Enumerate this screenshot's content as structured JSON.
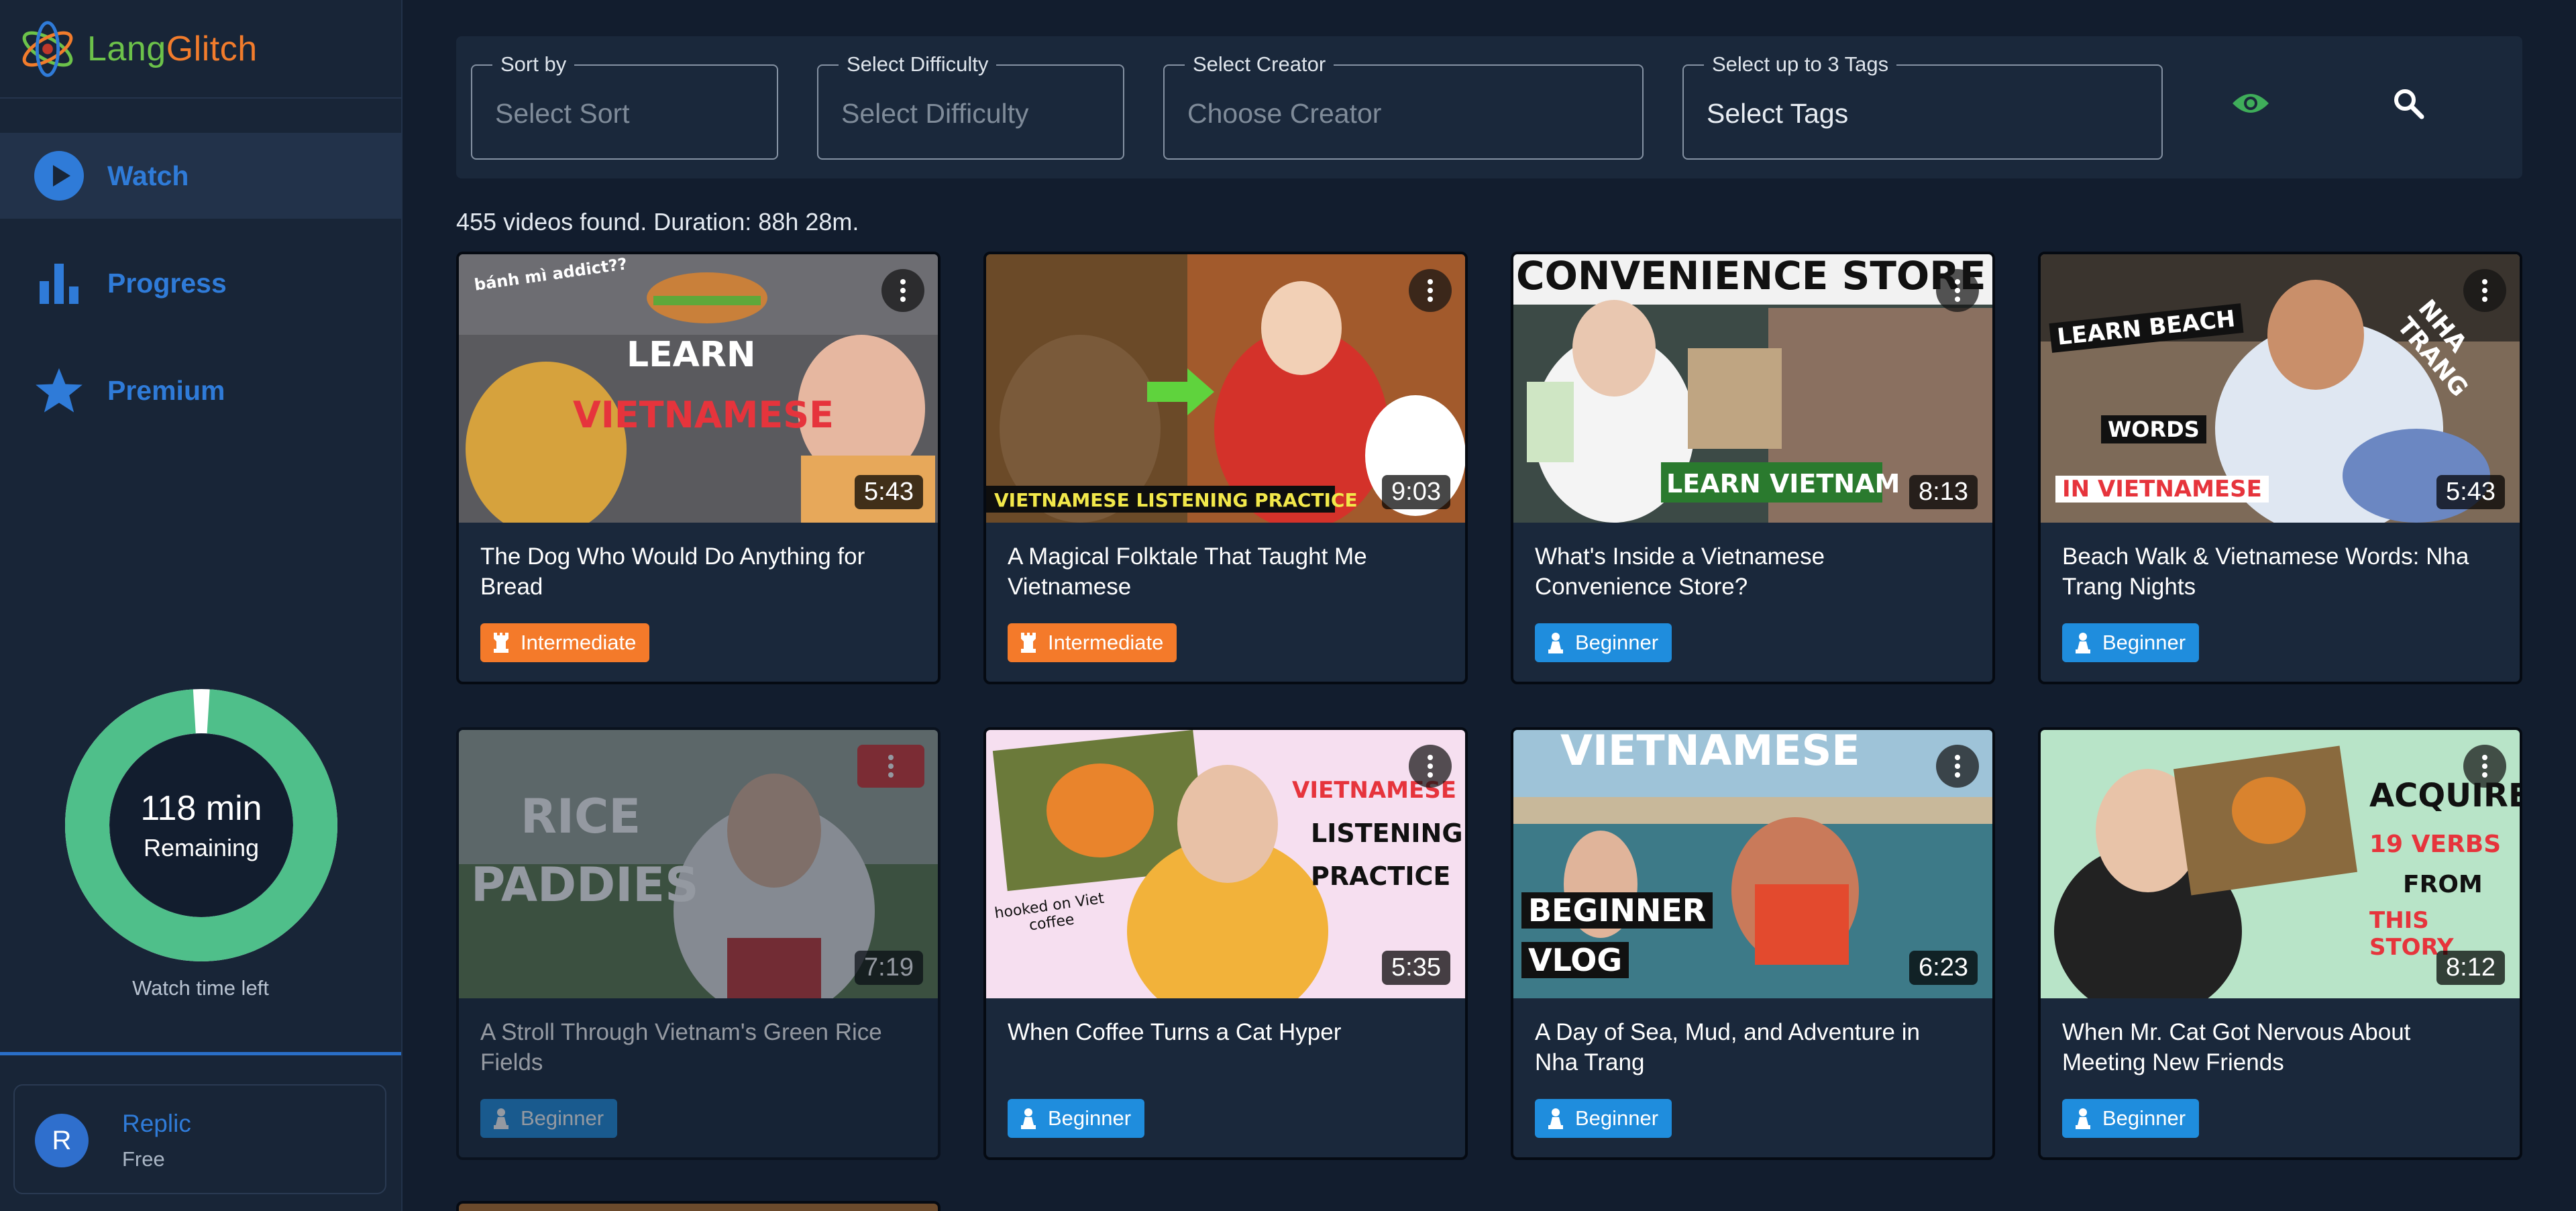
{
  "app": {
    "logo_part1": "Lang",
    "logo_part2": "Glitch",
    "brand_colors": {
      "green": "#6cc24a",
      "orange": "#f27c2c",
      "blue": "#2f7bd8"
    }
  },
  "sidebar": {
    "items": [
      {
        "label": "Watch",
        "icon": "play-circle-icon",
        "active": true
      },
      {
        "label": "Progress",
        "icon": "bar-chart-icon",
        "active": false
      },
      {
        "label": "Premium",
        "icon": "star-icon",
        "active": false
      }
    ],
    "watch_time": {
      "minutes_label": "118 min",
      "remaining_label": "Remaining",
      "caption": "Watch time left",
      "remaining_fraction": 0.98,
      "ring_color": "#4fbf8a"
    },
    "user": {
      "initial": "R",
      "name": "Replic",
      "plan": "Free"
    }
  },
  "filters": {
    "sort": {
      "legend": "Sort by",
      "placeholder": "Select Sort"
    },
    "difficulty": {
      "legend": "Select Difficulty",
      "placeholder": "Select Difficulty"
    },
    "creator": {
      "legend": "Select Creator",
      "placeholder": "Choose Creator"
    },
    "tags": {
      "legend": "Select up to 3 Tags",
      "placeholder": "Select Tags"
    },
    "eye_icon": "eye-icon",
    "search_icon": "search-icon"
  },
  "results_summary": "455 videos found. Duration: 88h 28m.",
  "videos": [
    {
      "title": "The Dog Who Would Do Anything for Bread",
      "duration": "5:43",
      "level": "Intermediate",
      "thumb_text": [
        "bánh mì addict??",
        "LEARN",
        "VIETNAMESE"
      ]
    },
    {
      "title": "A Magical Folktale That Taught Me Vietnamese",
      "duration": "9:03",
      "level": "Intermediate",
      "thumb_text": [
        "VIETNAMESE LISTENING PRACTICE"
      ]
    },
    {
      "title": "What's Inside a Vietnamese Convenience Store?",
      "duration": "8:13",
      "level": "Beginner",
      "thumb_text": [
        "CONVENIENCE STORE",
        "LEARN VIETNAM"
      ]
    },
    {
      "title": "Beach Walk & Vietnamese Words: Nha Trang Nights",
      "duration": "5:43",
      "level": "Beginner",
      "thumb_text": [
        "LEARN BEACH",
        "WORDS",
        "IN VIETNAMESE",
        "NHA TRANG"
      ]
    },
    {
      "title": "A Stroll Through Vietnam's Green Rice Fields",
      "duration": "7:19",
      "level": "Beginner",
      "thumb_text": [
        "RICE",
        "PADDIES"
      ],
      "watched": true
    },
    {
      "title": "When Coffee Turns a Cat Hyper",
      "duration": "5:35",
      "level": "Beginner",
      "thumb_text": [
        "VIETNAMESE",
        "LISTENING",
        "PRACTICE",
        "hooked on Viet coffee"
      ]
    },
    {
      "title": "A Day of Sea, Mud, and Adventure in Nha Trang",
      "duration": "6:23",
      "level": "Beginner",
      "thumb_text": [
        "VIETNAMESE",
        "BEGINNER",
        "VLOG"
      ]
    },
    {
      "title": "When Mr. Cat Got Nervous About Meeting New Friends",
      "duration": "8:12",
      "level": "Beginner",
      "thumb_text": [
        "ACQUIRE",
        "19 VERBS",
        "FROM",
        "THIS STORY"
      ]
    }
  ]
}
